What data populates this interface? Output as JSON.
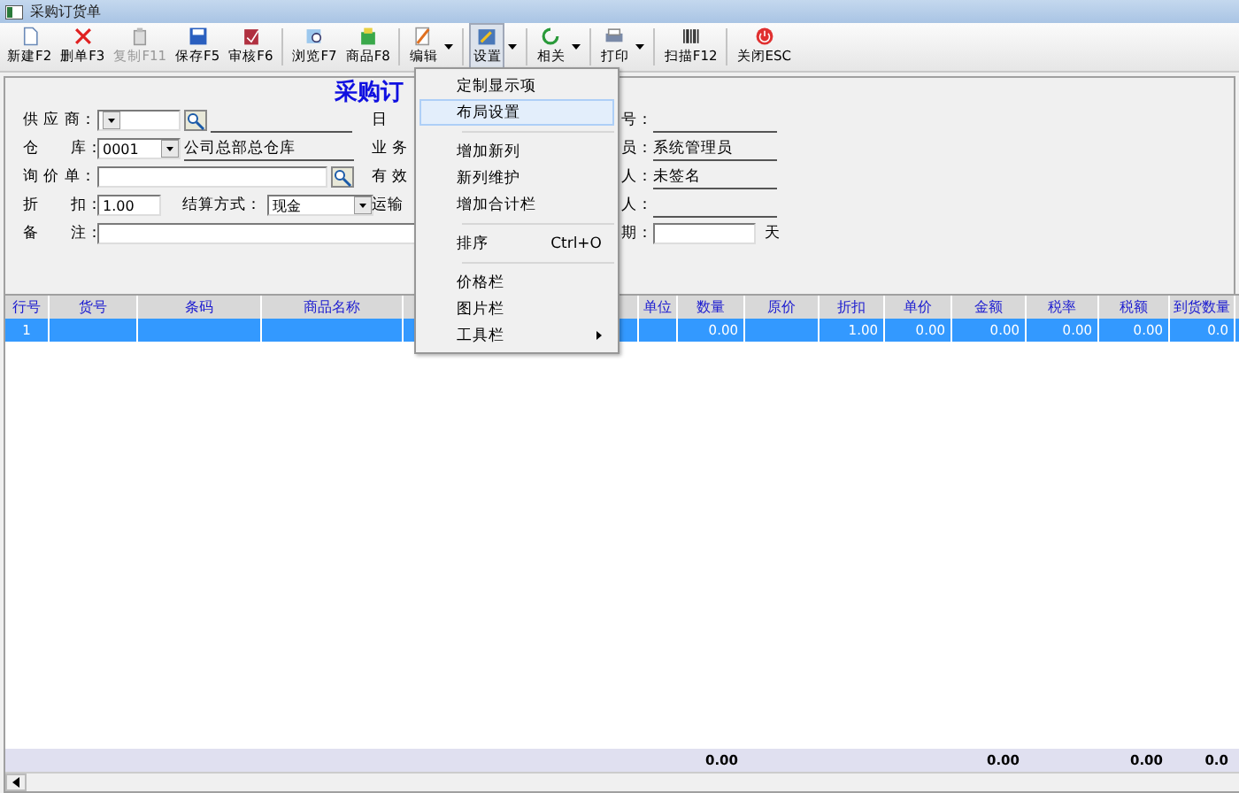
{
  "window": {
    "title": "采购订货单"
  },
  "toolbar": [
    {
      "label": "新建F2",
      "disabled": false,
      "dropdown": false,
      "pressed": false
    },
    {
      "label": "删单F3",
      "disabled": false,
      "dropdown": false,
      "pressed": false
    },
    {
      "label": "复制F11",
      "disabled": true,
      "dropdown": false,
      "pressed": false
    },
    {
      "label": "保存F5",
      "disabled": false,
      "dropdown": false,
      "pressed": false
    },
    {
      "label": "审核F6",
      "disabled": false,
      "dropdown": false,
      "pressed": false
    },
    {
      "label": "浏览F7",
      "disabled": false,
      "dropdown": false,
      "pressed": false
    },
    {
      "label": "商品F8",
      "disabled": false,
      "dropdown": false,
      "pressed": false
    },
    {
      "label": "编辑",
      "disabled": false,
      "dropdown": true,
      "pressed": false
    },
    {
      "label": "设置",
      "disabled": false,
      "dropdown": true,
      "pressed": true
    },
    {
      "label": "相关",
      "disabled": false,
      "dropdown": true,
      "pressed": false
    },
    {
      "label": "打印",
      "disabled": false,
      "dropdown": true,
      "pressed": false
    },
    {
      "label": "扫描F12",
      "disabled": false,
      "dropdown": false,
      "pressed": false
    },
    {
      "label": "关闭ESC",
      "disabled": false,
      "dropdown": false,
      "pressed": false
    }
  ],
  "form": {
    "title": "采购订",
    "left": [
      {
        "kind": "combo_lookup",
        "label": "供 应 商："
      },
      {
        "kind": "combo_text",
        "label": "仓　　库：",
        "value": "0001",
        "text": "公司总部总仓库"
      },
      {
        "kind": "lookup_field",
        "label": "询 价 单："
      },
      {
        "kind": "discount",
        "label": "折　　扣：",
        "value": "1.00",
        "settle_label": "结算方式：",
        "settle_value": "现金"
      },
      {
        "kind": "wide",
        "label": "备　　注："
      }
    ],
    "middle": [
      "日",
      "业 务",
      "有 效",
      "运输"
    ],
    "right": [
      {
        "kind": "line",
        "label": "号："
      },
      {
        "kind": "line",
        "label": "员：",
        "value": "系统管理员"
      },
      {
        "kind": "line",
        "label": "人：",
        "value": "未签名"
      },
      {
        "kind": "line",
        "label": "人："
      },
      {
        "kind": "days",
        "label": "期：",
        "unit": "天"
      }
    ]
  },
  "menu": [
    {
      "kind": "item",
      "label": "定制显示项",
      "selected": false
    },
    {
      "kind": "item",
      "label": "布局设置",
      "selected": true
    },
    {
      "kind": "separator"
    },
    {
      "kind": "item",
      "label": "增加新列",
      "selected": false
    },
    {
      "kind": "item",
      "label": "新列维护",
      "selected": false
    },
    {
      "kind": "item",
      "label": "增加合计栏",
      "selected": false
    },
    {
      "kind": "separator"
    },
    {
      "kind": "item",
      "label": "排序",
      "shortcut": "Ctrl+O",
      "selected": false
    },
    {
      "kind": "separator"
    },
    {
      "kind": "item",
      "label": "价格栏",
      "selected": false
    },
    {
      "kind": "item",
      "label": "图片栏",
      "selected": false
    },
    {
      "kind": "submenu",
      "label": "工具栏",
      "selected": false
    }
  ],
  "table": {
    "columns": [
      {
        "label": "行号"
      },
      {
        "label": "货号"
      },
      {
        "label": "条码"
      },
      {
        "label": "商品名称"
      },
      {},
      {},
      {
        "label": "单位"
      },
      {
        "label": "数量",
        "total": "0.00"
      },
      {
        "label": "原价"
      },
      {
        "label": "折扣"
      },
      {
        "label": "单价"
      },
      {
        "label": "金额",
        "total": "0.00"
      },
      {
        "label": "税率"
      },
      {
        "label": "税额",
        "total": "0.00"
      },
      {
        "label": "到货数量",
        "total": "0.0"
      }
    ],
    "rows": [
      {
        "selected": true,
        "cells": [
          {
            "text": "1"
          },
          {},
          {},
          {},
          {},
          {},
          {},
          {
            "text": "0.00"
          },
          {},
          {
            "text": "1.00"
          },
          {
            "text": "0.00"
          },
          {
            "text": "0.00"
          },
          {
            "text": "0.00"
          },
          {
            "text": "0.00"
          },
          {
            "text": "0.0"
          }
        ]
      }
    ]
  }
}
